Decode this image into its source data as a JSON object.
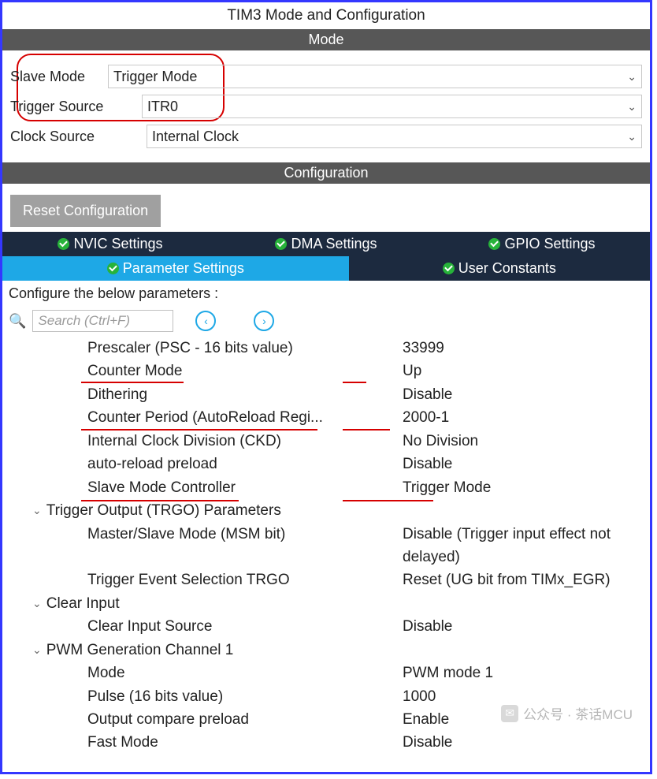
{
  "title": "TIM3 Mode and Configuration",
  "mode": {
    "header": "Mode",
    "rows": {
      "slave_mode": {
        "label": "Slave Mode",
        "value": "Trigger Mode"
      },
      "trigger_source": {
        "label": "Trigger Source",
        "value": "ITR0"
      },
      "clock_source": {
        "label": "Clock Source",
        "value": "Internal Clock"
      }
    }
  },
  "cfg": {
    "header": "Configuration",
    "reset": "Reset Configuration"
  },
  "tabs": {
    "nvic": "NVIC Settings",
    "dma": "DMA Settings",
    "gpio": "GPIO Settings",
    "param": "Parameter Settings",
    "user": "User Constants"
  },
  "param_header": "Configure the below parameters :",
  "search": {
    "placeholder": "Search (Ctrl+F)"
  },
  "params": {
    "prescaler": {
      "label": "Prescaler (PSC - 16 bits value)",
      "value": "33999"
    },
    "counter_mode": {
      "label": "Counter Mode",
      "value": "Up"
    },
    "dithering": {
      "label": "Dithering",
      "value": "Disable"
    },
    "counter_period": {
      "label": "Counter Period (AutoReload Regi...",
      "value": "2000-1"
    },
    "ckd": {
      "label": "Internal Clock Division (CKD)",
      "value": "No Division"
    },
    "arpe": {
      "label": "auto-reload preload",
      "value": "Disable"
    },
    "slave_ctrl": {
      "label": "Slave Mode Controller",
      "value": "Trigger Mode"
    }
  },
  "groups": {
    "trgo": "Trigger Output (TRGO) Parameters",
    "trgo_rows": {
      "msm": {
        "label": "Master/Slave Mode (MSM bit)",
        "value": "Disable (Trigger input effect not delayed)"
      },
      "tev": {
        "label": "Trigger Event Selection TRGO",
        "value": "Reset (UG bit from TIMx_EGR)"
      }
    },
    "clear": "Clear Input",
    "clear_rows": {
      "src": {
        "label": "Clear Input Source",
        "value": "Disable"
      }
    },
    "pwm": "PWM Generation Channel 1",
    "pwm_rows": {
      "mode": {
        "label": "Mode",
        "value": "PWM mode 1"
      },
      "pulse": {
        "label": "Pulse (16 bits value)",
        "value": "1000"
      },
      "ocpe": {
        "label": "Output compare preload",
        "value": "Enable"
      },
      "fast": {
        "label": "Fast Mode",
        "value": "Disable"
      }
    }
  },
  "watermark": {
    "text": "公众号 · 茶话MCU"
  }
}
